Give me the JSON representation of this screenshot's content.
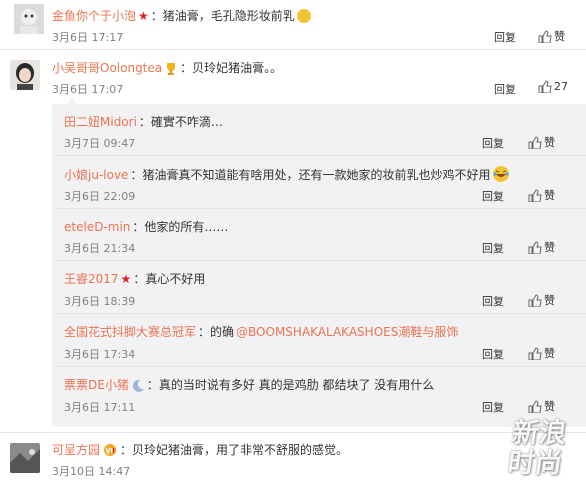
{
  "actions": {
    "reply": "回复",
    "like": "赞"
  },
  "top_comment": {
    "name": "金鱼你个于小泡",
    "text": "：猪油膏，毛孔隐形妆前乳",
    "time": "3月6日 17:17"
  },
  "main_comment": {
    "name": "小吴哥哥Oolongtea",
    "text": "：贝玲妃猪油膏。。",
    "time": "3月6日 17:07",
    "likes": "27"
  },
  "replies": [
    {
      "name": "田二妞Midori",
      "text": "：確實不咋滴…",
      "time": "3月7日 09:47"
    },
    {
      "name": "小娘ju-love",
      "text": "：猪油膏真不知道能有啥用处，还有一款她家的妆前乳也炒鸡不好用",
      "time": "3月6日 22:09"
    },
    {
      "name": "eteleD-min",
      "text": "：他家的所有……",
      "time": "3月6日 21:34"
    },
    {
      "name": "王睿2017",
      "text": "：真心不好用",
      "time": "3月6日 18:39"
    },
    {
      "name": "全国花式抖脚大赛总冠军",
      "text": "：的确",
      "mention": "@BOOMSHAKALAKASHOES潮鞋与服饰",
      "time": "3月6日 17:34"
    },
    {
      "name": "票票DE小猪",
      "text": "：真的当时说有多好 真的是鸡肋 都结块了 没有用什么",
      "time": "3月6日 17:11"
    }
  ],
  "bottom_comment": {
    "name": "可呈方园",
    "text": "：贝玲妃猪油膏，用了非常不舒服的感觉。",
    "time": "3月10日 14:47"
  },
  "watermark": "新浪时尚"
}
